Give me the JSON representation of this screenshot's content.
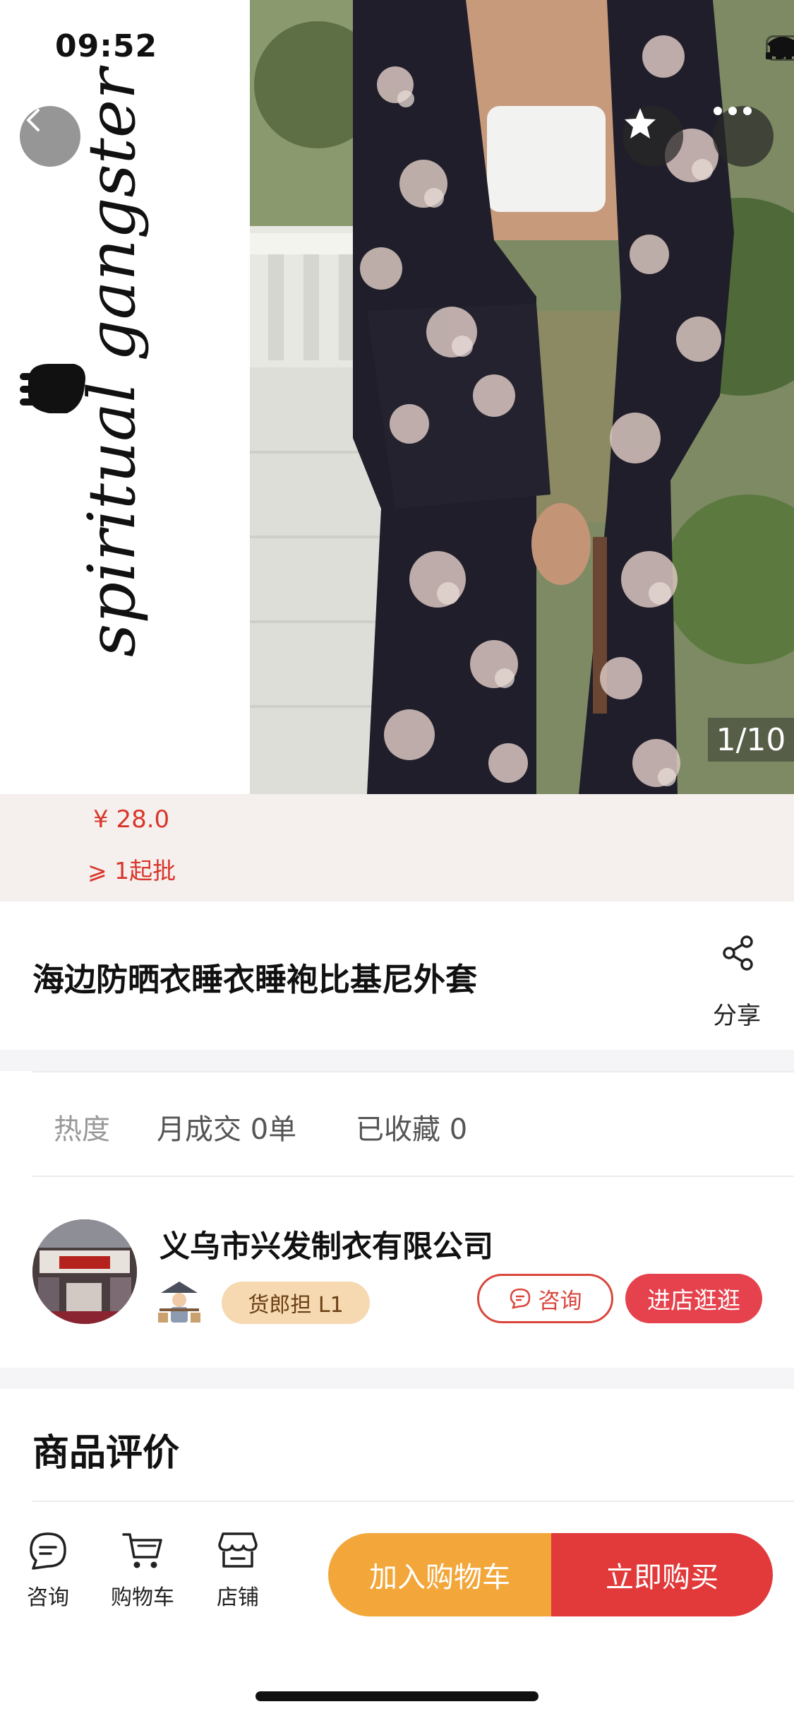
{
  "status_bar": {
    "time": "09:52",
    "battery_level": 0.7
  },
  "gallery": {
    "counter": "1/10",
    "brand_mark_text": "spiritual gangster"
  },
  "price": {
    "amount": "¥ 28.0",
    "min_order": "⩾ 1起批"
  },
  "product": {
    "title": "海边防晒衣睡衣睡袍比基尼外套",
    "share_label": "分享"
  },
  "stats": {
    "heat_label": "热度",
    "monthly_deals": "月成交 0单",
    "favorites": "已收藏 0"
  },
  "shop": {
    "name": "义乌市兴发制衣有限公司",
    "level_badge": "货郎担 L1",
    "consult_label": "咨询",
    "visit_label": "进店逛逛"
  },
  "reviews": {
    "title": "商品评价"
  },
  "bottom_nav": {
    "tabs": [
      {
        "label": "咨询",
        "icon": "chat-icon"
      },
      {
        "label": "购物车",
        "icon": "cart-icon"
      },
      {
        "label": "店铺",
        "icon": "store-icon"
      }
    ],
    "add_to_cart": "加入购物车",
    "buy_now": "立即购买"
  },
  "colors": {
    "accent_red": "#e2393a",
    "cart_orange": "#f3a73a",
    "price_red": "#d9362b",
    "badge_bg": "#f6d9b1"
  }
}
